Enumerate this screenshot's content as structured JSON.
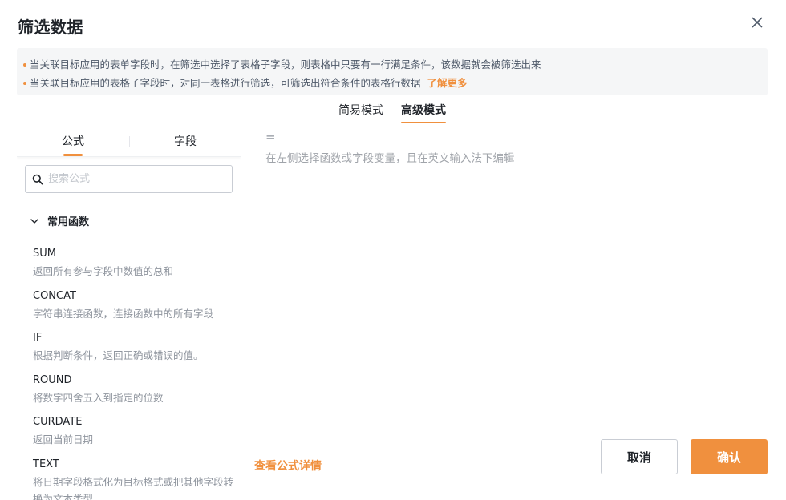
{
  "dialog": {
    "title": "筛选数据",
    "close_icon": "close-icon"
  },
  "notice": {
    "lines": [
      "当关联目标应用的表单字段时，在筛选中选择了表格子字段，则表格中只要有一行满足条件，该数据就会被筛选出来",
      "当关联目标应用的表格子字段时，对同一表格进行筛选，可筛选出符合条件的表格行数据"
    ],
    "learn_more": "了解更多"
  },
  "mode_tabs": {
    "simple": "简易模式",
    "advanced": "高级模式",
    "active": "advanced"
  },
  "side_tabs": {
    "formula": "公式",
    "field": "字段",
    "active": "formula"
  },
  "search": {
    "placeholder": "搜索公式",
    "value": ""
  },
  "group": {
    "label": "常用函数",
    "expanded": true
  },
  "functions": [
    {
      "name": "SUM",
      "desc": "返回所有参与字段中数值的总和"
    },
    {
      "name": "CONCAT",
      "desc": "字符串连接函数，连接函数中的所有字段"
    },
    {
      "name": "IF",
      "desc": "根据判断条件，返回正确或错误的值。"
    },
    {
      "name": "ROUND",
      "desc": "将数字四舍五入到指定的位数"
    },
    {
      "name": "CURDATE",
      "desc": "返回当前日期"
    },
    {
      "name": "TEXT",
      "desc": "将日期字段格式化为目标格式或把其他字段转换为文本类型"
    }
  ],
  "editor": {
    "prefix": "=",
    "hint": "在左侧选择函数或字段变量，且在英文输入法下编辑"
  },
  "footer": {
    "view_details": "查看公式详情",
    "cancel": "取消",
    "confirm": "确认"
  },
  "colors": {
    "accent": "#f0903e",
    "notice_bg": "#f5f6f7"
  }
}
